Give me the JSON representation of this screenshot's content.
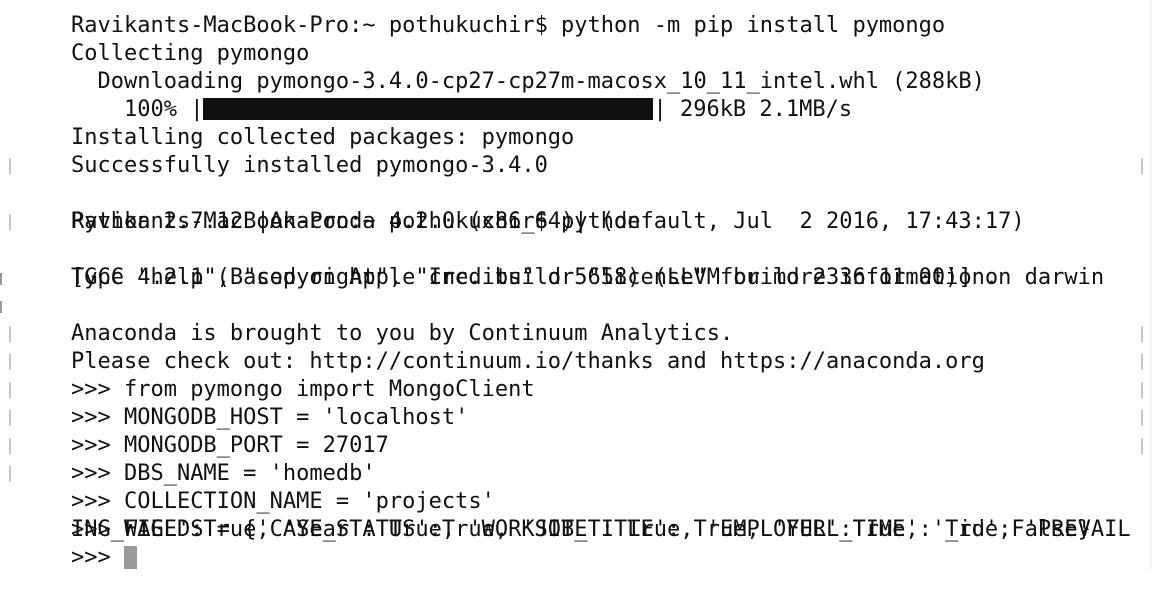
{
  "terminal": {
    "lines": [
      "Ravikants-MacBook-Pro:~ pothukuchir$ python -m pip install pymongo",
      "Collecting pymongo",
      "  Downloading pymongo-3.4.0-cp27-cp27m-macosx_10_11_intel.whl (288kB)",
      "",
      "Installing collected packages: pymongo",
      "Successfully installed pymongo-3.4.0",
      "Ravikants-MacBook-Pro:~ pothukuchir$ python",
      "Python 2.7.12 |Anaconda 4.2.0 (x86_64)| (default, Jul  2 2016, 17:43:17)",
      "[GCC 4.2.1 (Based on Apple Inc. build 5658) (LLVM build 2336.11.00)] on darwin",
      "Type \"help\", \"copyright\", \"credits\" or \"license\" for more information.",
      "Anaconda is brought to you by Continuum Analytics.",
      "Please check out: http://continuum.io/thanks and https://anaconda.org",
      ">>> from pymongo import MongoClient",
      ">>> MONGODB_HOST = 'localhost'",
      ">>> MONGODB_PORT = 27017",
      ">>> DBS_NAME = 'homedb'",
      ">>> COLLECTION_NAME = 'projects'",
      ">>> FIELDS = {'CASE_STATUS':True, 'JOB_TITLE': True, 'FULL_TIME': True, 'PREVAIL",
      "ING_WAGE':True, 'Year': True, 'WORKSITE': True, 'EMPLOYER':True, '_id':False}",
      ">>> "
    ],
    "progress": {
      "indent": "    ",
      "percent_label": "100%",
      "open_bracket": " |",
      "close_bracket": "| ",
      "size_label": "296kB",
      "rate_label": " 2.1MB/s",
      "fraction": 1.0
    },
    "colors": {
      "text": "#111111",
      "background": "#ffffff",
      "cursor": "#9a9a9a",
      "marker": "#c8c8c8"
    },
    "icons": {
      "cursor": "block-cursor-icon",
      "line-mark": "line-marker-icon"
    }
  }
}
